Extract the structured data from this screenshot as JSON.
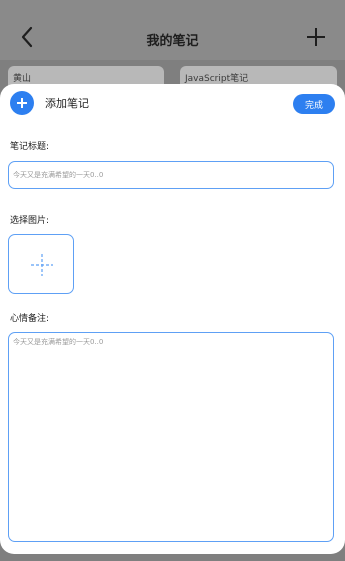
{
  "background": {
    "header_title": "我的笔记",
    "cards": [
      {
        "label": "黄山"
      },
      {
        "label": "JavaScript笔记"
      }
    ]
  },
  "modal": {
    "title": "添加笔记",
    "done_label": "完成",
    "title_field": {
      "label": "笔记标题:",
      "placeholder": "今天又是充满希望的一天0..0"
    },
    "image_field": {
      "label": "选择图片:"
    },
    "notes_field": {
      "label": "心情备注:",
      "placeholder": "今天又是充满希望的一天0..0"
    }
  },
  "colors": {
    "accent": "#2d7ff0",
    "input_border": "#5ea0f5"
  },
  "icons": {
    "back": "chevron-left-icon",
    "add": "plus-icon",
    "add_note": "plus-circle-icon",
    "image_placeholder": "dashed-plus-icon"
  }
}
